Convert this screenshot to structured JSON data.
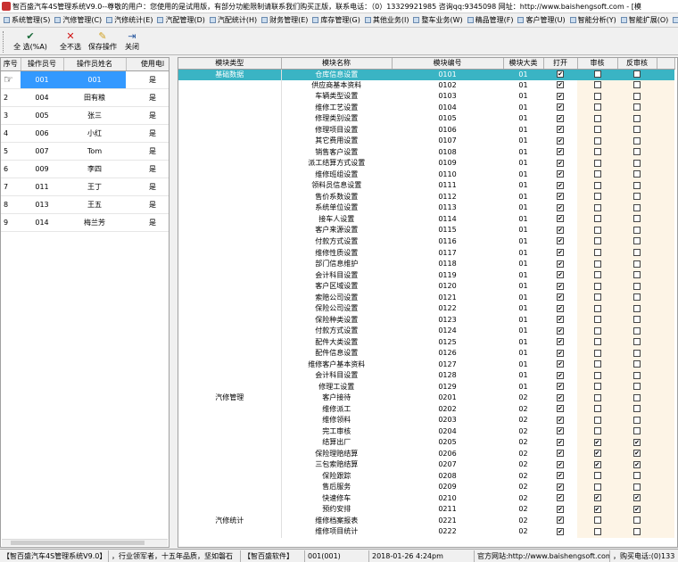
{
  "window": {
    "title": "智百盛汽车4S管理系统V9.0--尊敬的用户：您使用的是试用版，有部分功能限制请联系我们购买正版，联系电话：（0）13329921985  咨询qq:9345098  网址：http://www.baishengsoft.com - [模"
  },
  "menu": [
    "系统管理(S)",
    "汽修管理(C)",
    "汽修统计(E)",
    "汽配管理(D)",
    "汽配统计(H)",
    "财务管理(E)",
    "库存管理(G)",
    "其他业务(I)",
    "整车业务(W)",
    "精品管理(F)",
    "客户管理(U)",
    "智能分析(Y)",
    "智能扩展(O)",
    "基础数"
  ],
  "toolbar": {
    "select_all": "全  选(%A)",
    "select_none": "全不选",
    "save": "保存操作",
    "close": "关闭"
  },
  "left_table": {
    "headers": [
      "序号",
      "操作员号",
      "操作员姓名",
      "使用电l"
    ],
    "rows": [
      {
        "seq": "",
        "code": "001",
        "name": "001",
        "active": "是"
      },
      {
        "seq": "2",
        "code": "004",
        "name": "田有粮",
        "active": "是"
      },
      {
        "seq": "3",
        "code": "005",
        "name": "张三",
        "active": "是"
      },
      {
        "seq": "4",
        "code": "006",
        "name": "小红",
        "active": "是"
      },
      {
        "seq": "5",
        "code": "007",
        "name": "Tom",
        "active": "是"
      },
      {
        "seq": "6",
        "code": "009",
        "name": "李四",
        "active": "是"
      },
      {
        "seq": "7",
        "code": "011",
        "name": "王丁",
        "active": "是"
      },
      {
        "seq": "8",
        "code": "013",
        "name": "王五",
        "active": "是"
      },
      {
        "seq": "9",
        "code": "014",
        "name": "梅兰芳",
        "active": "是"
      }
    ]
  },
  "right_table": {
    "headers": [
      "模块类型",
      "模块名称",
      "模块编号",
      "模块大类",
      "打开",
      "审核",
      "反审核"
    ],
    "rows": [
      {
        "type": "基础数据",
        "name": "仓库信息设置",
        "code": "0101",
        "cat": "01",
        "open": true,
        "audit": false,
        "unaudit": false
      },
      {
        "type": "",
        "name": "供应商基本资料",
        "code": "0102",
        "cat": "01",
        "open": true,
        "audit": false,
        "unaudit": false
      },
      {
        "type": "",
        "name": "车辆类型设置",
        "code": "0103",
        "cat": "01",
        "open": true,
        "audit": false,
        "unaudit": false
      },
      {
        "type": "",
        "name": "维修工艺设置",
        "code": "0104",
        "cat": "01",
        "open": true,
        "audit": false,
        "unaudit": false
      },
      {
        "type": "",
        "name": "修理类别设置",
        "code": "0105",
        "cat": "01",
        "open": true,
        "audit": false,
        "unaudit": false
      },
      {
        "type": "",
        "name": "修理项目设置",
        "code": "0106",
        "cat": "01",
        "open": true,
        "audit": false,
        "unaudit": false
      },
      {
        "type": "",
        "name": "其它费用设置",
        "code": "0107",
        "cat": "01",
        "open": true,
        "audit": false,
        "unaudit": false
      },
      {
        "type": "",
        "name": "销售客户设置",
        "code": "0108",
        "cat": "01",
        "open": true,
        "audit": false,
        "unaudit": false
      },
      {
        "type": "",
        "name": "派工结算方式设置",
        "code": "0109",
        "cat": "01",
        "open": true,
        "audit": false,
        "unaudit": false
      },
      {
        "type": "",
        "name": "维修班组设置",
        "code": "0110",
        "cat": "01",
        "open": true,
        "audit": false,
        "unaudit": false
      },
      {
        "type": "",
        "name": "领料员信息设置",
        "code": "0111",
        "cat": "01",
        "open": true,
        "audit": false,
        "unaudit": false
      },
      {
        "type": "",
        "name": "售价系数设置",
        "code": "0112",
        "cat": "01",
        "open": true,
        "audit": false,
        "unaudit": false
      },
      {
        "type": "",
        "name": "系统单位设置",
        "code": "0113",
        "cat": "01",
        "open": true,
        "audit": false,
        "unaudit": false
      },
      {
        "type": "",
        "name": "接车人设置",
        "code": "0114",
        "cat": "01",
        "open": true,
        "audit": false,
        "unaudit": false
      },
      {
        "type": "",
        "name": "客户来源设置",
        "code": "0115",
        "cat": "01",
        "open": true,
        "audit": false,
        "unaudit": false
      },
      {
        "type": "",
        "name": "付款方式设置",
        "code": "0116",
        "cat": "01",
        "open": true,
        "audit": false,
        "unaudit": false
      },
      {
        "type": "",
        "name": "维修性质设置",
        "code": "0117",
        "cat": "01",
        "open": true,
        "audit": false,
        "unaudit": false
      },
      {
        "type": "",
        "name": "部门信息维护",
        "code": "0118",
        "cat": "01",
        "open": true,
        "audit": false,
        "unaudit": false
      },
      {
        "type": "",
        "name": "会计科目设置",
        "code": "0119",
        "cat": "01",
        "open": true,
        "audit": false,
        "unaudit": false
      },
      {
        "type": "",
        "name": "客户区域设置",
        "code": "0120",
        "cat": "01",
        "open": true,
        "audit": false,
        "unaudit": false
      },
      {
        "type": "",
        "name": "索赔公司设置",
        "code": "0121",
        "cat": "01",
        "open": true,
        "audit": false,
        "unaudit": false
      },
      {
        "type": "",
        "name": "保险公司设置",
        "code": "0122",
        "cat": "01",
        "open": true,
        "audit": false,
        "unaudit": false
      },
      {
        "type": "",
        "name": "保险种类设置",
        "code": "0123",
        "cat": "01",
        "open": true,
        "audit": false,
        "unaudit": false
      },
      {
        "type": "",
        "name": "付款方式设置",
        "code": "0124",
        "cat": "01",
        "open": true,
        "audit": false,
        "unaudit": false
      },
      {
        "type": "",
        "name": "配件大类设置",
        "code": "0125",
        "cat": "01",
        "open": true,
        "audit": false,
        "unaudit": false
      },
      {
        "type": "",
        "name": "配件信息设置",
        "code": "0126",
        "cat": "01",
        "open": true,
        "audit": false,
        "unaudit": false
      },
      {
        "type": "",
        "name": "维修客户基本资料",
        "code": "0127",
        "cat": "01",
        "open": true,
        "audit": false,
        "unaudit": false
      },
      {
        "type": "",
        "name": "会计科目设置",
        "code": "0128",
        "cat": "01",
        "open": true,
        "audit": false,
        "unaudit": false
      },
      {
        "type": "",
        "name": "修理工设置",
        "code": "0129",
        "cat": "01",
        "open": true,
        "audit": false,
        "unaudit": false
      },
      {
        "type": "汽修管理",
        "name": "客户接待",
        "code": "0201",
        "cat": "02",
        "open": true,
        "audit": false,
        "unaudit": false
      },
      {
        "type": "",
        "name": "维修派工",
        "code": "0202",
        "cat": "02",
        "open": true,
        "audit": false,
        "unaudit": false
      },
      {
        "type": "",
        "name": "维修领料",
        "code": "0203",
        "cat": "02",
        "open": true,
        "audit": false,
        "unaudit": false
      },
      {
        "type": "",
        "name": "完工审核",
        "code": "0204",
        "cat": "02",
        "open": true,
        "audit": false,
        "unaudit": false
      },
      {
        "type": "",
        "name": "结算出厂",
        "code": "0205",
        "cat": "02",
        "open": true,
        "audit": true,
        "unaudit": true
      },
      {
        "type": "",
        "name": "保险理赔结算",
        "code": "0206",
        "cat": "02",
        "open": true,
        "audit": true,
        "unaudit": true
      },
      {
        "type": "",
        "name": "三包索赔结算",
        "code": "0207",
        "cat": "02",
        "open": true,
        "audit": true,
        "unaudit": true
      },
      {
        "type": "",
        "name": "保险跟踪",
        "code": "0208",
        "cat": "02",
        "open": true,
        "audit": false,
        "unaudit": false
      },
      {
        "type": "",
        "name": "售后服务",
        "code": "0209",
        "cat": "02",
        "open": true,
        "audit": false,
        "unaudit": false
      },
      {
        "type": "",
        "name": "快速修车",
        "code": "0210",
        "cat": "02",
        "open": true,
        "audit": true,
        "unaudit": true
      },
      {
        "type": "",
        "name": "预约安排",
        "code": "0211",
        "cat": "02",
        "open": true,
        "audit": true,
        "unaudit": true
      },
      {
        "type": "汽修统计",
        "name": "维修档案报表",
        "code": "0221",
        "cat": "02",
        "open": true,
        "audit": false,
        "unaudit": false
      },
      {
        "type": "",
        "name": "维修项目统计",
        "code": "0222",
        "cat": "02",
        "open": true,
        "audit": false,
        "unaudit": false
      }
    ]
  },
  "status": {
    "product": "【智百盛汽车4S管理系统V9.0】",
    "slogan": "，行业领军者，十五年品质，坚如磐石",
    "brand": "【智百盛软件】",
    "user": "001(001)",
    "datetime": "2018-01-26 4:24pm",
    "website": "官方网站:http://www.baishengsoft.com",
    "phone": "，购买电话:(0)133"
  },
  "colors": {
    "selection": "#3399ff",
    "grid_highlight": "#3ab4c4",
    "audit_column_bg": "#fdf4e6"
  },
  "icons": {
    "select_all": "check-all-icon",
    "select_none": "red-x-icon",
    "save": "save-icon",
    "close": "exit-icon",
    "row_pointer": "hand-pointer-icon"
  }
}
